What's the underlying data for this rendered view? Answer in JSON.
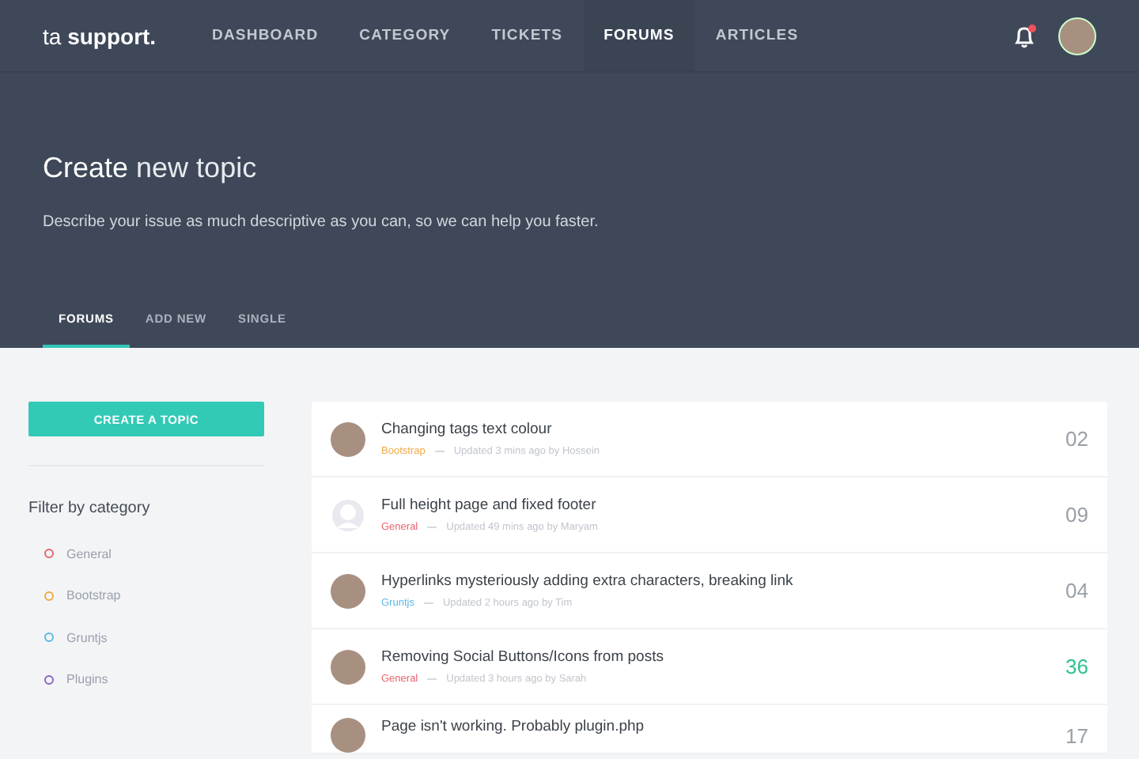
{
  "logo": {
    "light": "ta",
    "bold": "support."
  },
  "nav": [
    {
      "label": "DASHBOARD",
      "selected": false
    },
    {
      "label": "CATEGORY",
      "selected": false
    },
    {
      "label": "TICKETS",
      "selected": false
    },
    {
      "label": "FORUMS",
      "selected": true
    },
    {
      "label": "ARTICLES",
      "selected": false
    }
  ],
  "notifications": {
    "unread": true
  },
  "hero": {
    "title_lead": "Create",
    "title_rest": "new topic",
    "subtitle": "Describe your issue as much descriptive as you can, so we can help you faster."
  },
  "tabs": [
    {
      "label": "FORUMS",
      "selected": true
    },
    {
      "label": "ADD NEW",
      "selected": false
    },
    {
      "label": "SINGLE",
      "selected": false
    }
  ],
  "sidebar": {
    "button": "CREATE A TOPIC",
    "filter_title": "Filter by category",
    "categories": [
      {
        "label": "General",
        "color": "#e5636b"
      },
      {
        "label": "Bootstrap",
        "color": "#f1a948"
      },
      {
        "label": "Gruntjs",
        "color": "#5bb8e0"
      },
      {
        "label": "Plugins",
        "color": "#8a63c4"
      }
    ]
  },
  "topics": [
    {
      "kind": "photo",
      "title": "Changing tags text colour",
      "category": "Bootstrap",
      "color": "#f1a948",
      "meta": "Updated 3 mins ago by Hossein",
      "count": "02",
      "hot": false
    },
    {
      "kind": "placeholder",
      "title": "Full height page and fixed footer",
      "category": "General",
      "color": "#e5636b",
      "meta": "Updated 49 mins ago by Maryam",
      "count": "09",
      "hot": false
    },
    {
      "kind": "photo",
      "title": "Hyperlinks mysteriously adding extra characters, breaking link",
      "category": "Gruntjs",
      "color": "#5bb8e0",
      "meta": "Updated 2 hours ago by Tim",
      "count": "04",
      "hot": false
    },
    {
      "kind": "photo",
      "title": "Removing Social Buttons/Icons from posts",
      "category": "General",
      "color": "#e5636b",
      "meta": "Updated 3 hours ago by Sarah",
      "count": "36",
      "hot": true
    },
    {
      "kind": "photo",
      "title": "Page isn't working. Probably plugin.php",
      "count": "17",
      "hot": false
    }
  ]
}
